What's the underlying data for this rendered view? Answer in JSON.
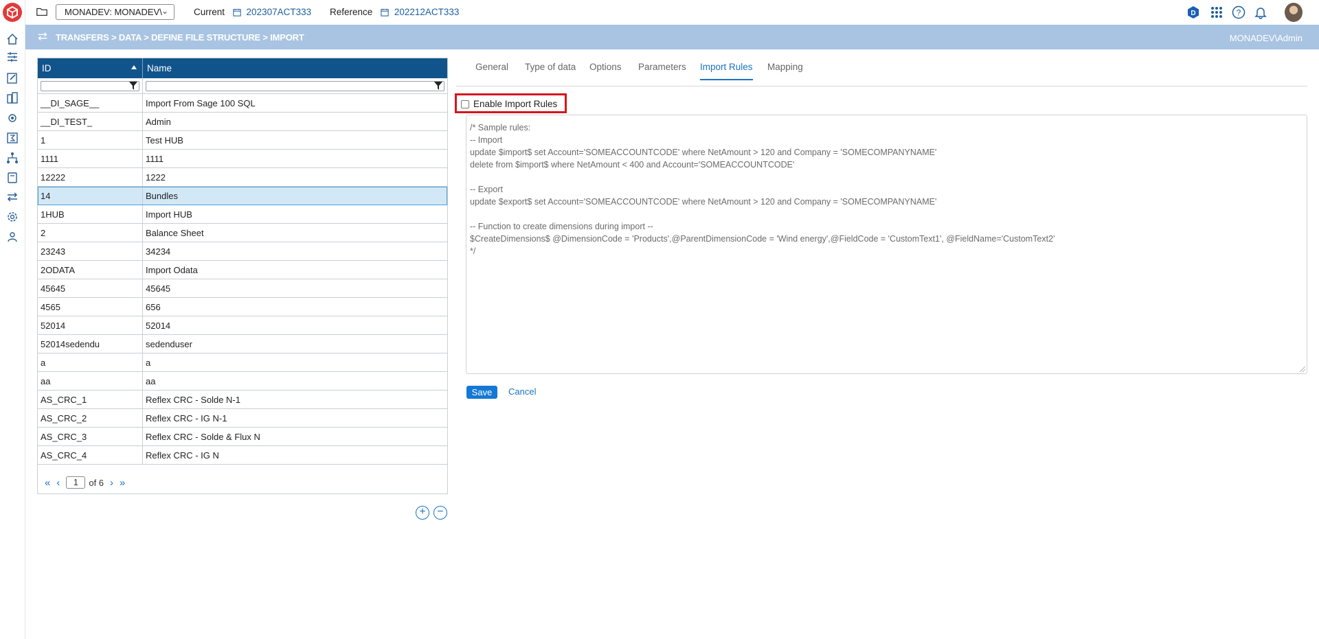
{
  "topbar": {
    "environment": "MONADEV: MONADEV\\",
    "current_label": "Current",
    "current_value": "202307ACT333",
    "reference_label": "Reference",
    "reference_value": "202212ACT333"
  },
  "band": {
    "breadcrumb": "TRANSFERS > DATA > DEFINE FILE STRUCTURE > IMPORT",
    "user": "MONADEV\\Admin"
  },
  "grid": {
    "columns": [
      "ID",
      "Name"
    ],
    "rows": [
      {
        "id": "__DI_SAGE__",
        "name": "Import From Sage 100 SQL"
      },
      {
        "id": "__DI_TEST_",
        "name": "Admin"
      },
      {
        "id": "1",
        "name": "Test HUB"
      },
      {
        "id": "1111",
        "name": "1111"
      },
      {
        "id": "12222",
        "name": "1222"
      },
      {
        "id": "14",
        "name": "Bundles"
      },
      {
        "id": "1HUB",
        "name": "Import HUB"
      },
      {
        "id": "2",
        "name": "Balance Sheet"
      },
      {
        "id": "23243",
        "name": "34234"
      },
      {
        "id": "2ODATA",
        "name": "Import Odata"
      },
      {
        "id": "45645",
        "name": "45645"
      },
      {
        "id": "4565",
        "name": "656"
      },
      {
        "id": "52014",
        "name": "52014"
      },
      {
        "id": "52014sedendu",
        "name": "sedenduser"
      },
      {
        "id": "a",
        "name": "a"
      },
      {
        "id": "aa",
        "name": "aa"
      },
      {
        "id": "AS_CRC_1",
        "name": "Reflex CRC - Solde N-1"
      },
      {
        "id": "AS_CRC_2",
        "name": "Reflex CRC - IG N-1"
      },
      {
        "id": "AS_CRC_3",
        "name": "Reflex CRC - Solde & Flux N"
      },
      {
        "id": "AS_CRC_4",
        "name": "Reflex CRC - IG N"
      }
    ],
    "selected_row_id": "14",
    "pager": {
      "page": "1",
      "of_text": "of 6"
    }
  },
  "tabs": [
    "General",
    "Type of data",
    "Options",
    "Parameters",
    "Import Rules",
    "Mapping"
  ],
  "active_tab": "Import Rules",
  "enable_import_rules": {
    "label": "Enable Import Rules",
    "checked": false
  },
  "rules_text": "/* Sample rules:\n-- Import\nupdate $import$ set Account='SOMEACCOUNTCODE' where NetAmount > 120 and Company = 'SOMECOMPANYNAME'\ndelete from $import$ where NetAmount < 400 and Account='SOMEACCOUNTCODE'\n\n-- Export\nupdate $export$ set Account='SOMEACCOUNTCODE' where NetAmount > 120 and Company = 'SOMECOMPANYNAME'\n\n-- Function to create dimensions during import --\n$CreateDimensions$ @DimensionCode = 'Products',@ParentDimensionCode = 'Wind energy',@FieldCode = 'CustomText1', @FieldName='CustomText2'\n*/",
  "buttons": {
    "save": "Save",
    "cancel": "Cancel"
  },
  "colors": {
    "header_blue": "#11548b",
    "band_blue": "#a9c4e2",
    "accent": "#1478d4",
    "highlight_red": "#d6151d"
  },
  "icons": [
    "app-logo-icon",
    "home-icon",
    "folder-icon",
    "calendar-icon",
    "filter-icon",
    "transfer-icon",
    "help-icon",
    "bell-icon",
    "apps-grid-icon"
  ]
}
